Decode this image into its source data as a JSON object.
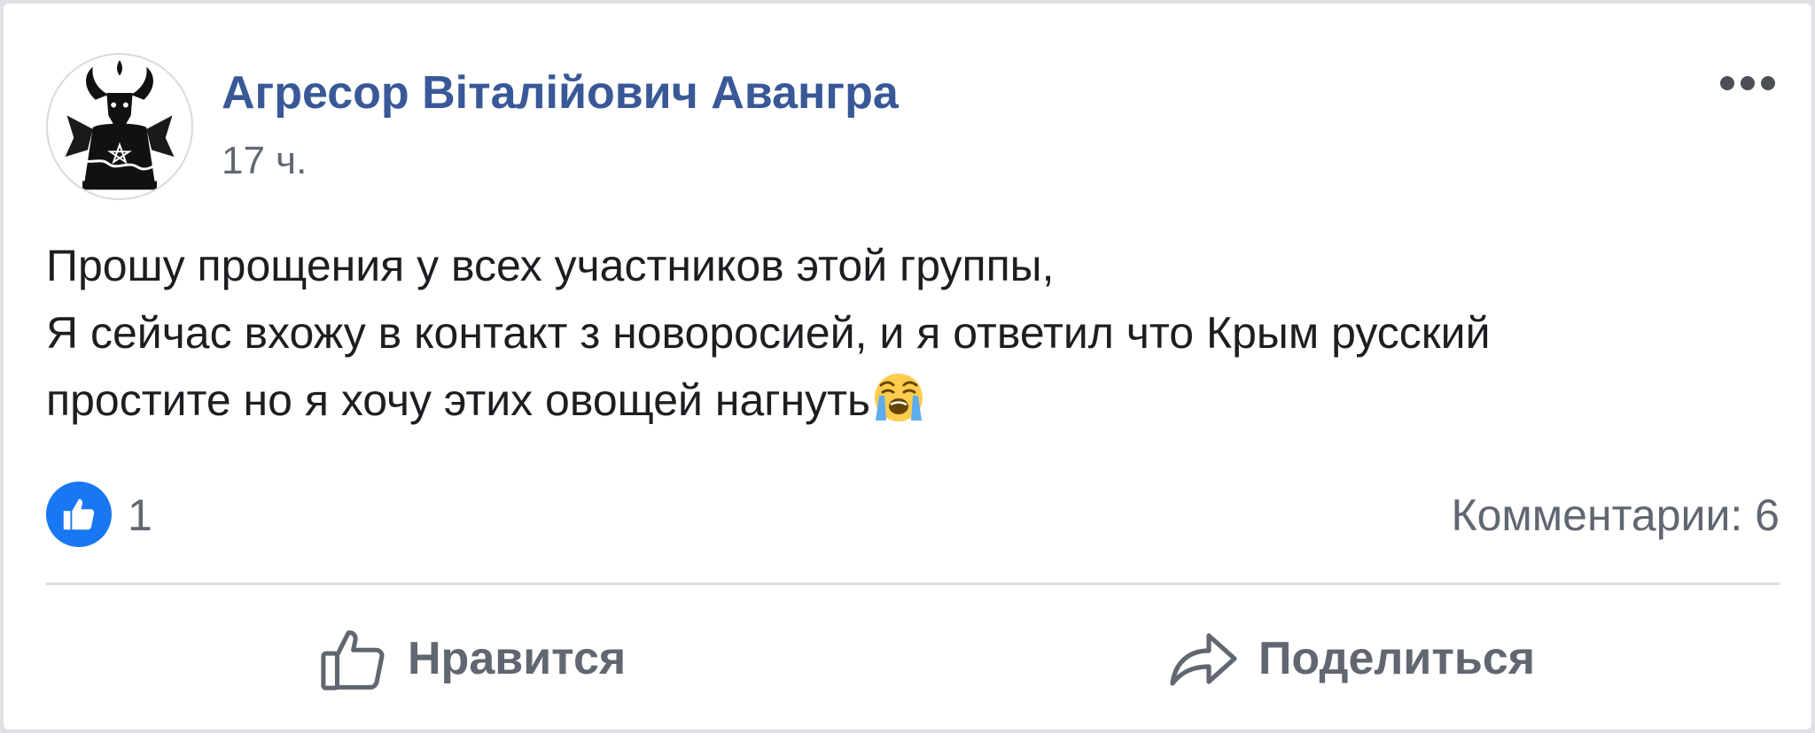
{
  "post": {
    "author": "Агресор Віталійович Авангра",
    "time": "17 ч.",
    "text_lines": [
      "Прошу прощения у всех участников этой группы,",
      "Я сейчас вхожу в контакт з новоросией, и я ответил что Крым русский",
      "простите но я хочу этих овощей нагнуть"
    ],
    "emoji": "loudly-crying-face"
  },
  "reactions": {
    "like_count": "1",
    "comments": "Комментарии: 6"
  },
  "actions": {
    "like_label": "Нравится",
    "share_label": "Поделиться"
  },
  "colors": {
    "author": "#385898",
    "secondary_text": "#606770",
    "like_badge": "#1877f2"
  }
}
